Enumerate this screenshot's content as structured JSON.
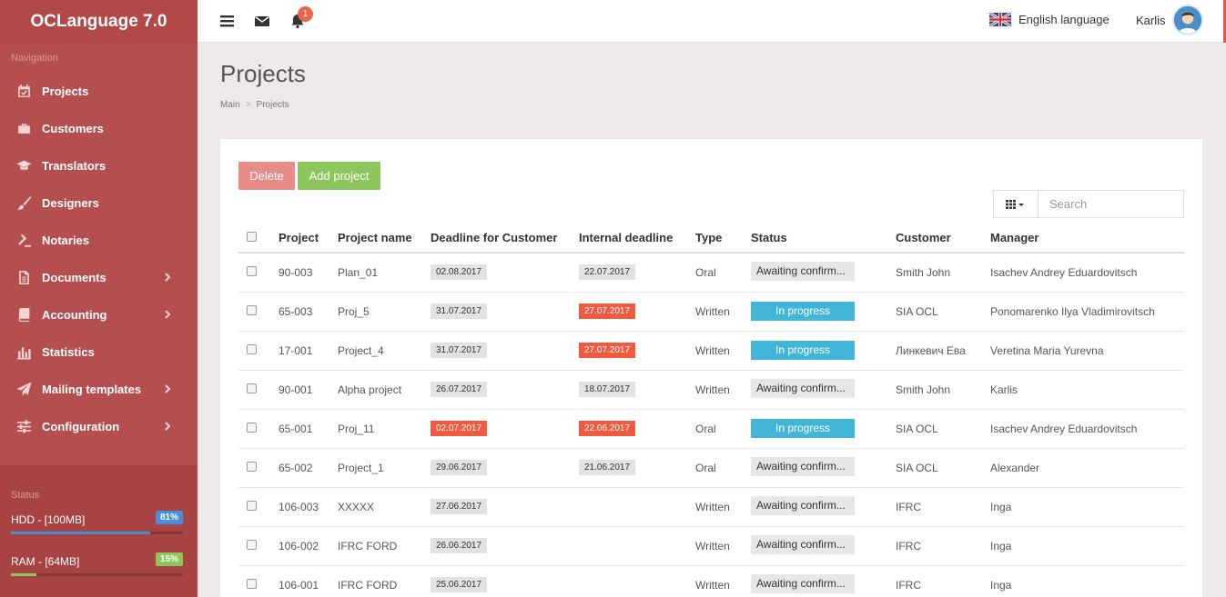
{
  "app": {
    "title": "OCLanguage 7.0"
  },
  "sidebar": {
    "nav_heading": "Navigation",
    "items": [
      {
        "label": "Projects",
        "icon": "calendar-check-icon",
        "has_submenu": false
      },
      {
        "label": "Customers",
        "icon": "briefcase-icon",
        "has_submenu": false
      },
      {
        "label": "Translators",
        "icon": "graduation-cap-icon",
        "has_submenu": false
      },
      {
        "label": "Designers",
        "icon": "paint-brush-icon",
        "has_submenu": false
      },
      {
        "label": "Notaries",
        "icon": "gavel-icon",
        "has_submenu": false
      },
      {
        "label": "Documents",
        "icon": "document-icon",
        "has_submenu": true
      },
      {
        "label": "Accounting",
        "icon": "book-icon",
        "has_submenu": true
      },
      {
        "label": "Statistics",
        "icon": "bar-chart-icon",
        "has_submenu": false
      },
      {
        "label": "Mailing templates",
        "icon": "paper-plane-icon",
        "has_submenu": true
      },
      {
        "label": "Configuration",
        "icon": "sliders-icon",
        "has_submenu": true
      }
    ],
    "status_heading": "Status",
    "status": [
      {
        "label": "HDD - [100MB]",
        "percent_label": "81%",
        "percent": 81,
        "color": "#4a90d9"
      },
      {
        "label": "RAM - [64MB]",
        "percent_label": "15%",
        "percent": 15,
        "color": "#8dc65d"
      }
    ]
  },
  "topbar": {
    "notification_count": "1",
    "language": "English language",
    "user": "Karlis"
  },
  "page": {
    "title": "Projects",
    "breadcrumb": [
      "Main",
      "Projects"
    ]
  },
  "toolbar": {
    "delete_label": "Delete",
    "add_label": "Add project",
    "search_placeholder": "Search"
  },
  "table": {
    "columns": [
      "Project",
      "Project name",
      "Deadline for Customer",
      "Internal deadline",
      "Type",
      "Status",
      "Customer",
      "Manager"
    ],
    "rows": [
      {
        "project": "90-003",
        "name": "Plan_01",
        "deadline": "02.08.2017",
        "deadline_overdue": false,
        "internal": "22.07.2017",
        "internal_overdue": false,
        "type": "Oral",
        "status": "Awaiting confirm...",
        "status_kind": "awaiting",
        "customer": "Smith John",
        "manager": "Isachev Andrey Eduardovitsch"
      },
      {
        "project": "65-003",
        "name": "Proj_5",
        "deadline": "31.07.2017",
        "deadline_overdue": false,
        "internal": "27.07.2017",
        "internal_overdue": true,
        "type": "Written",
        "status": "In progress",
        "status_kind": "progress",
        "customer": "SIA OCL",
        "manager": "Ponomarenko Ilya Vladimirovitsch"
      },
      {
        "project": "17-001",
        "name": "Project_4",
        "deadline": "31.07.2017",
        "deadline_overdue": false,
        "internal": "27.07.2017",
        "internal_overdue": true,
        "type": "Written",
        "status": "In progress",
        "status_kind": "progress",
        "customer": "Линкевич Ева",
        "manager": "Veretina Maria Yurevna"
      },
      {
        "project": "90-001",
        "name": "Alpha project",
        "deadline": "26.07.2017",
        "deadline_overdue": false,
        "internal": "18.07.2017",
        "internal_overdue": false,
        "type": "Written",
        "status": "Awaiting confirm...",
        "status_kind": "awaiting",
        "customer": "Smith John",
        "manager": "Karlis"
      },
      {
        "project": "65-001",
        "name": "Proj_11",
        "deadline": "02.07.2017",
        "deadline_overdue": true,
        "internal": "22.06.2017",
        "internal_overdue": true,
        "type": "Oral",
        "status": "In progress",
        "status_kind": "progress",
        "customer": "SIA OCL",
        "manager": "Isachev Andrey Eduardovitsch"
      },
      {
        "project": "65-002",
        "name": "Project_1",
        "deadline": "29.06.2017",
        "deadline_overdue": false,
        "internal": "21.06.2017",
        "internal_overdue": false,
        "type": "Oral",
        "status": "Awaiting confirm...",
        "status_kind": "awaiting",
        "customer": "SIA OCL",
        "manager": "Alexander"
      },
      {
        "project": "106-003",
        "name": "XXXXX",
        "deadline": "27.06.2017",
        "deadline_overdue": false,
        "internal": "",
        "internal_overdue": false,
        "type": "Written",
        "status": "Awaiting confirm...",
        "status_kind": "awaiting",
        "customer": "IFRC",
        "manager": "Inga"
      },
      {
        "project": "106-002",
        "name": "IFRC FORD",
        "deadline": "26.06.2017",
        "deadline_overdue": false,
        "internal": "",
        "internal_overdue": false,
        "type": "Written",
        "status": "Awaiting confirm...",
        "status_kind": "awaiting",
        "customer": "IFRC",
        "manager": "Inga"
      },
      {
        "project": "106-001",
        "name": "IFRC FORD",
        "deadline": "25.06.2017",
        "deadline_overdue": false,
        "internal": "",
        "internal_overdue": false,
        "type": "Written",
        "status": "Awaiting confirm...",
        "status_kind": "awaiting",
        "customer": "IFRC",
        "manager": "Inga"
      }
    ]
  }
}
